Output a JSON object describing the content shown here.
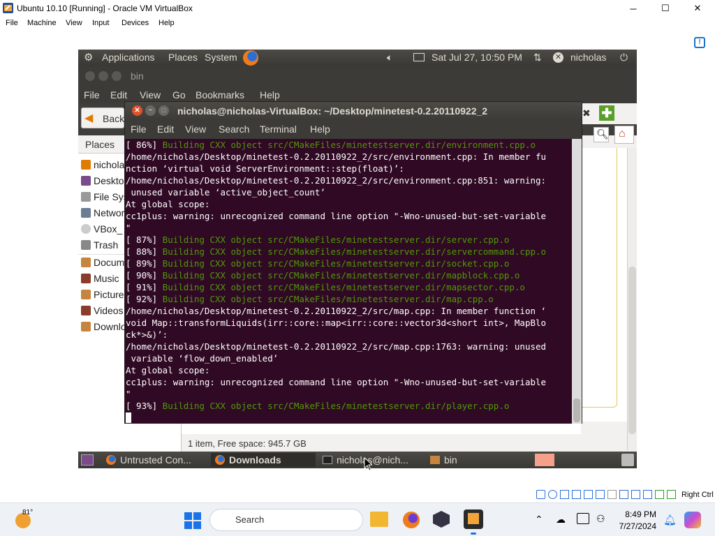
{
  "host": {
    "title": "Ubuntu 10.10 [Running] - Oracle VM VirtualBox",
    "menu": [
      "File",
      "Machine",
      "View",
      "Input",
      "Devices",
      "Help"
    ],
    "host_key": "Right Ctrl"
  },
  "guest_panel": {
    "applications": "Applications",
    "places": "Places",
    "system": "System",
    "clock": "Sat Jul 27, 10:50 PM",
    "user": "nicholas"
  },
  "nautilus": {
    "title": "bin",
    "menu": [
      "File",
      "Edit",
      "View",
      "Go",
      "Bookmarks",
      "Help"
    ],
    "back_label": "Back",
    "places_label": "Places",
    "sidebar": [
      "nicholas",
      "Desktop",
      "File System",
      "Network",
      "VBox_",
      "Trash",
      "Documents",
      "Music",
      "Pictures",
      "Videos",
      "Downloads"
    ],
    "status": "1 item, Free space: 945.7 GB"
  },
  "terminal": {
    "title": "nicholas@nicholas-VirtualBox: ~/Desktop/minetest-0.2.20110922_2",
    "menu": [
      "File",
      "Edit",
      "View",
      "Search",
      "Terminal",
      "Help"
    ],
    "lines": [
      {
        "p": "[ 86%] ",
        "g": "Building CXX object src/CMakeFiles/minetestserver.dir/environment.cpp.o"
      },
      {
        "p": "/home/nicholas/Desktop/minetest-0.2.20110922_2/src/environment.cpp: In member fu",
        "g": ""
      },
      {
        "p": "nction ‘virtual void ServerEnvironment::step(float)’:",
        "g": ""
      },
      {
        "p": "/home/nicholas/Desktop/minetest-0.2.20110922_2/src/environment.cpp:851: warning:",
        "g": ""
      },
      {
        "p": " unused variable ‘active_object_count’",
        "g": ""
      },
      {
        "p": "At global scope:",
        "g": ""
      },
      {
        "p": "cc1plus: warning: unrecognized command line option \"-Wno-unused-but-set-variable",
        "g": ""
      },
      {
        "p": "\"",
        "g": ""
      },
      {
        "p": "[ 87%] ",
        "g": "Building CXX object src/CMakeFiles/minetestserver.dir/server.cpp.o"
      },
      {
        "p": "[ 88%] ",
        "g": "Building CXX object src/CMakeFiles/minetestserver.dir/servercommand.cpp.o"
      },
      {
        "p": "[ 89%] ",
        "g": "Building CXX object src/CMakeFiles/minetestserver.dir/socket.cpp.o"
      },
      {
        "p": "[ 90%] ",
        "g": "Building CXX object src/CMakeFiles/minetestserver.dir/mapblock.cpp.o"
      },
      {
        "p": "[ 91%] ",
        "g": "Building CXX object src/CMakeFiles/minetestserver.dir/mapsector.cpp.o"
      },
      {
        "p": "[ 92%] ",
        "g": "Building CXX object src/CMakeFiles/minetestserver.dir/map.cpp.o"
      },
      {
        "p": "/home/nicholas/Desktop/minetest-0.2.20110922_2/src/map.cpp: In member function ‘",
        "g": ""
      },
      {
        "p": "void Map::transformLiquids(irr::core::map<irr::core::vector3d<short int>, MapBlo",
        "g": ""
      },
      {
        "p": "ck*>&)’:",
        "g": ""
      },
      {
        "p": "/home/nicholas/Desktop/minetest-0.2.20110922_2/src/map.cpp:1763: warning: unused",
        "g": ""
      },
      {
        "p": " variable ‘flow_down_enabled’",
        "g": ""
      },
      {
        "p": "At global scope:",
        "g": ""
      },
      {
        "p": "cc1plus: warning: unrecognized command line option \"-Wno-unused-but-set-variable",
        "g": ""
      },
      {
        "p": "\"",
        "g": ""
      },
      {
        "p": "[ 93%] ",
        "g": "Building CXX object src/CMakeFiles/minetestserver.dir/player.cpp.o"
      }
    ]
  },
  "guest_taskbar": [
    {
      "label": "Untrusted Con...",
      "icon": "firefox-icon",
      "active": false
    },
    {
      "label": "Downloads",
      "icon": "firefox-icon",
      "active": true
    },
    {
      "label": "nicholas@nich...",
      "icon": "terminal-icon",
      "active": false
    },
    {
      "label": "bin",
      "icon": "folder-icon",
      "active": false
    }
  ],
  "win_taskbar": {
    "weather": "81°",
    "search_placeholder": "Search",
    "time": "8:49 PM",
    "date": "7/27/2024"
  },
  "colors": {
    "terminal_bg": "#300a24",
    "terminal_green": "#4e9a06",
    "ubuntu_panel": "#3c3b37"
  }
}
